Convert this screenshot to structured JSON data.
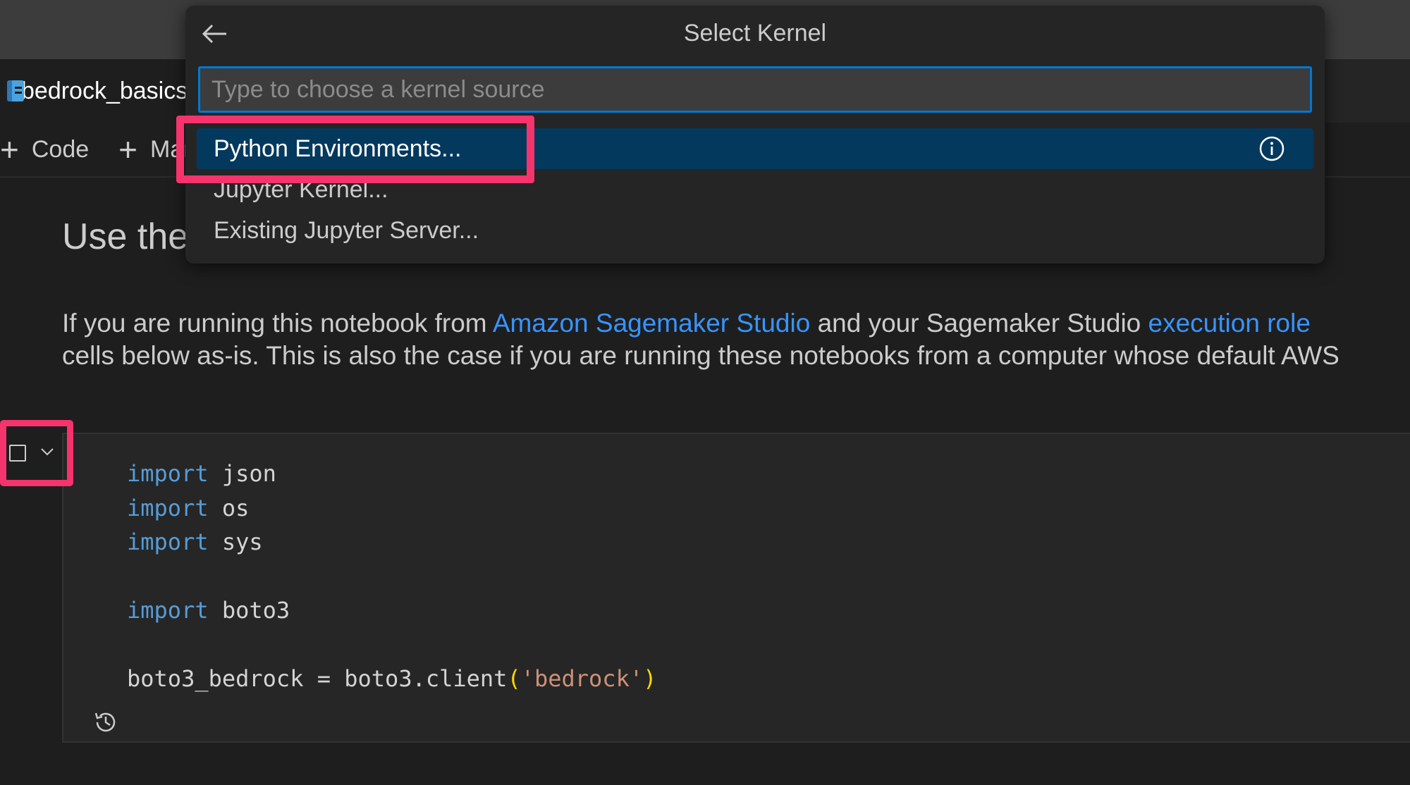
{
  "editor": {
    "tab_title": "bedrock_basics.ipynb",
    "toolbar": {
      "code_label": "Code",
      "markdown_label": "Markdown"
    }
  },
  "markdown": {
    "heading": "Use the",
    "para_line1_before": "If you are running this notebook from ",
    "link_studio": "Amazon Sagemaker Studio",
    "para_line1_mid": " and your Sagemaker Studio ",
    "link_role": "execution role",
    "para_line2": "cells below as-is. This is also the case if you are running these notebooks from a computer whose default AWS"
  },
  "code_cell": {
    "lines": [
      [
        {
          "t": "import",
          "c": "kw"
        },
        {
          "t": " json",
          "c": ""
        }
      ],
      [
        {
          "t": "import",
          "c": "kw"
        },
        {
          "t": " os",
          "c": ""
        }
      ],
      [
        {
          "t": "import",
          "c": "kw"
        },
        {
          "t": " sys",
          "c": ""
        }
      ],
      [],
      [
        {
          "t": "import",
          "c": "kw"
        },
        {
          "t": " boto3",
          "c": ""
        }
      ],
      [],
      [
        {
          "t": "boto3_bedrock = boto3.client",
          "c": ""
        },
        {
          "t": "(",
          "c": "paren"
        },
        {
          "t": "'bedrock'",
          "c": "str"
        },
        {
          "t": ")",
          "c": "paren"
        }
      ]
    ]
  },
  "kernel_picker": {
    "title": "Select Kernel",
    "input_placeholder": "Type to choose a kernel source",
    "input_value": "",
    "items": [
      {
        "label": "Python Environments..."
      },
      {
        "label": "Jupyter Kernel..."
      },
      {
        "label": "Existing Jupyter Server..."
      }
    ],
    "icons": {
      "back": "arrow-left-icon",
      "info": "info-icon"
    }
  },
  "colors": {
    "highlight": "#f5336c",
    "link": "#3794ff",
    "active_item": "#04395e",
    "focus_border": "#0078d4"
  }
}
